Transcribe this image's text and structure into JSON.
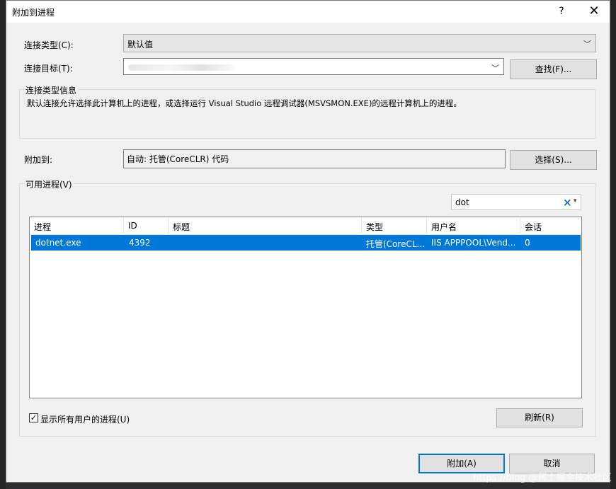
{
  "window": {
    "title": "附加到进程",
    "help_glyph": "?",
    "close_glyph": "✕"
  },
  "connection": {
    "type_label": "连接类型(C):",
    "type_value": "默认值",
    "target_label": "连接目标(T):",
    "find_button": "查找(F)...",
    "info_legend": "连接类型信息",
    "info_text": "默认连接允许选择此计算机上的进程，或选择运行 Visual Studio 远程调试器(MSVSMON.EXE)的远程计算机上的进程。"
  },
  "attach": {
    "label": "附加到:",
    "value": "自动: 托管(CoreCLR) 代码",
    "select_button": "选择(S)..."
  },
  "processes": {
    "legend": "可用进程(V)",
    "filter_value": "dot",
    "columns": [
      "进程",
      "ID",
      "标题",
      "类型",
      "用户名",
      "会话"
    ],
    "rows": [
      {
        "process": "dotnet.exe",
        "id": "4392",
        "title": "",
        "type": "托管(CoreCL...",
        "user": "IIS APPPOOL\\Vend...",
        "session": "0"
      }
    ],
    "show_all_label": "显示所有用户的进程(U)",
    "show_all_checked": true,
    "refresh_button": "刷新(R)"
  },
  "footer": {
    "attach_button": "附加(A)",
    "cancel_button": "取消"
  },
  "watermark": "https://blog @稀土掘金技术社区",
  "icons": {
    "dropdown": "chevron-down-icon",
    "clear": "clear-x-icon",
    "check": "checkmark-icon"
  },
  "colors": {
    "selection": "#0078d7",
    "dialog_bg": "#f0f0f0",
    "accent_border": "#0078d7"
  }
}
